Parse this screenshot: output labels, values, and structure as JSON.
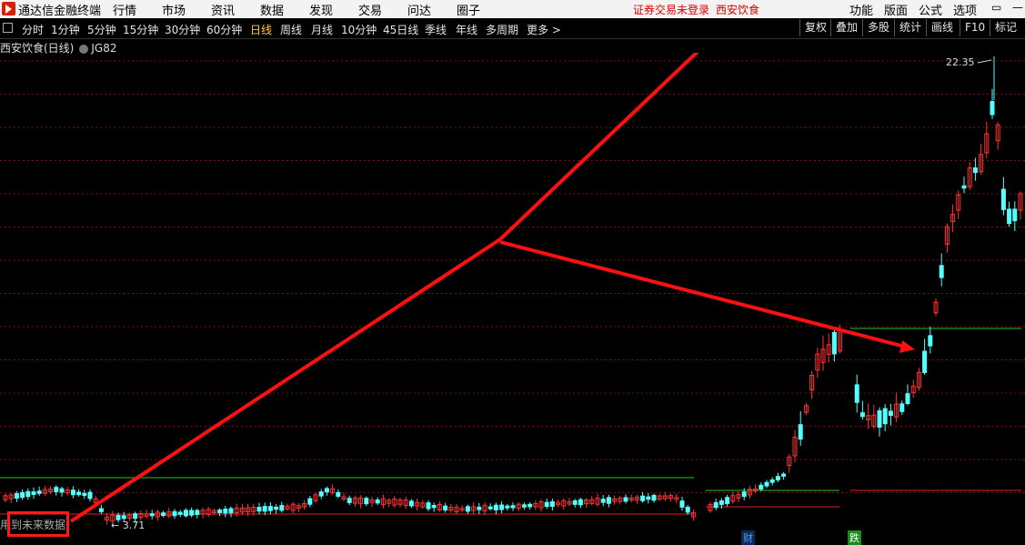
{
  "app": {
    "title": "通达信金融终端"
  },
  "menu": [
    "行情",
    "市场",
    "资讯",
    "数据",
    "发现",
    "交易",
    "问达",
    "圈子"
  ],
  "notice": {
    "text": "证券交易未登录",
    "stock": "西安饮食"
  },
  "right_menu": [
    "功能",
    "版面",
    "公式",
    "选项"
  ],
  "periods": [
    "分时",
    "1分钟",
    "5分钟",
    "15分钟",
    "30分钟",
    "60分钟",
    "日线",
    "周线",
    "月线",
    "10分钟",
    "45日线",
    "季线",
    "年线",
    "多周期",
    "更多 >"
  ],
  "active_period": "日线",
  "tools": [
    "复权",
    "叠加",
    "多股",
    "统计",
    "画线",
    "F10",
    "标记"
  ],
  "chart_title": {
    "name": "西安饮食(日线)",
    "indicator": "JG82"
  },
  "price_labels": {
    "high": "22.35",
    "low": "3.71"
  },
  "badges": {
    "cai": "财",
    "die": "跌"
  },
  "bottom_text": "用到未来数据",
  "colors": {
    "up": "#ff3232",
    "down": "#54ffff",
    "grid": "#7a1010",
    "green_line": "#23c023",
    "red_line": "#e02020",
    "arrow": "#ff1010"
  }
}
